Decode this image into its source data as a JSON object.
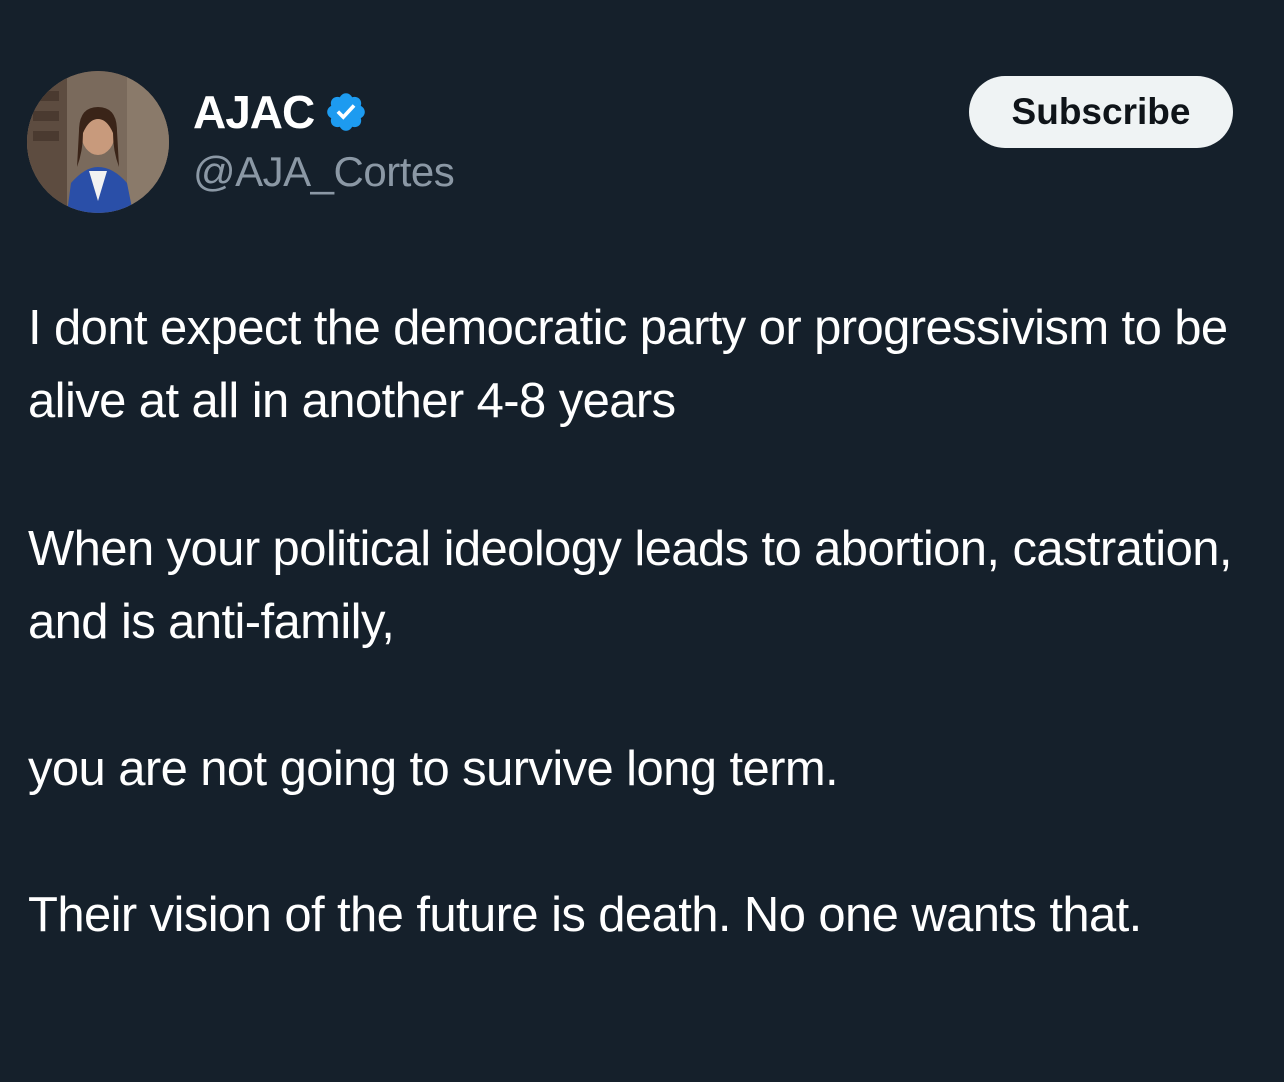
{
  "author": {
    "display_name": "AJAC",
    "handle": "@AJA_Cortes",
    "verified": true,
    "avatar_icon": "profile-photo"
  },
  "actions": {
    "subscribe_label": "Subscribe"
  },
  "tweet": {
    "paragraphs": [
      "I dont expect the democratic party or progressivism to be alive at all in another 4-8 years",
      "When your political ideology leads to abortion, castration, and is anti-family,",
      "you are not going to survive long term.",
      "Their vision of the future is death. No one wants that."
    ]
  },
  "colors": {
    "background": "#15202b",
    "text_primary": "#ffffff",
    "text_secondary": "#8b98a5",
    "verified_badge": "#1d9bf0",
    "button_bg": "#eff3f4",
    "button_text": "#0f1419"
  }
}
